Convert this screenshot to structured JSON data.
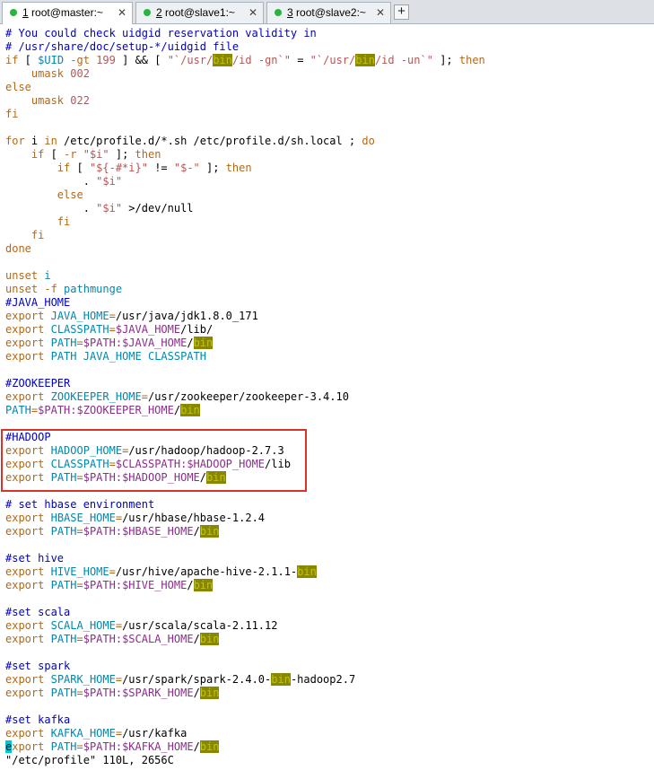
{
  "tabs": [
    {
      "num": "1",
      "title": "root@master:~",
      "close": "✕",
      "active": true
    },
    {
      "num": "2",
      "title": "root@slave1:~",
      "close": "✕",
      "active": false
    },
    {
      "num": "3",
      "title": "root@slave2:~",
      "close": "✕",
      "active": false
    }
  ],
  "new_tab_label": "+",
  "colors": {
    "comment": "#0000c0",
    "keyword": "#b26818",
    "string": "#b65555",
    "variable": "#0087af",
    "path": "#8a2d8a",
    "search_highlight": "#878700",
    "cursor": "#00c8d8",
    "annotation_box": "#d9342b",
    "running_dot": "#27b53f"
  },
  "terminal": {
    "lines": [
      [
        [
          "c",
          "# You could check uidgid reservation validity in"
        ]
      ],
      [
        [
          "c",
          "# /usr/share/doc/setup-*/uidgid file"
        ]
      ],
      [
        [
          "k",
          "if"
        ],
        [
          "p",
          " [ "
        ],
        [
          "v",
          "$UID"
        ],
        [
          "p",
          " "
        ],
        [
          "k",
          "-gt"
        ],
        [
          "p",
          " "
        ],
        [
          "s",
          "199"
        ],
        [
          "p",
          " ] && [ "
        ],
        [
          "s",
          "\"`/usr/"
        ],
        [
          "h",
          "bin"
        ],
        [
          "s",
          "/id -gn`\""
        ],
        [
          "p",
          " = "
        ],
        [
          "s",
          "\"`/usr/"
        ],
        [
          "h",
          "bin"
        ],
        [
          "s",
          "/id -un`\""
        ],
        [
          "p",
          " ]; "
        ],
        [
          "k",
          "then"
        ]
      ],
      [
        [
          "p",
          "    "
        ],
        [
          "k",
          "umask"
        ],
        [
          "p",
          " "
        ],
        [
          "s",
          "002"
        ]
      ],
      [
        [
          "k",
          "else"
        ]
      ],
      [
        [
          "p",
          "    "
        ],
        [
          "k",
          "umask"
        ],
        [
          "p",
          " "
        ],
        [
          "s",
          "022"
        ]
      ],
      [
        [
          "k",
          "fi"
        ]
      ],
      [
        [
          "p",
          ""
        ]
      ],
      [
        [
          "k",
          "for"
        ],
        [
          "p",
          " i "
        ],
        [
          "k",
          "in"
        ],
        [
          "p",
          " /etc/profile.d/*.sh /etc/profile.d/sh.local ; "
        ],
        [
          "k",
          "do"
        ]
      ],
      [
        [
          "p",
          "    "
        ],
        [
          "k",
          "if"
        ],
        [
          "p",
          " [ "
        ],
        [
          "k",
          "-r"
        ],
        [
          "p",
          " "
        ],
        [
          "s",
          "\"$i\""
        ],
        [
          "p",
          " ]; "
        ],
        [
          "k",
          "then"
        ]
      ],
      [
        [
          "p",
          "        "
        ],
        [
          "k",
          "if"
        ],
        [
          "p",
          " [ "
        ],
        [
          "s",
          "\"${-#*i}\""
        ],
        [
          "p",
          " != "
        ],
        [
          "s",
          "\"$-\""
        ],
        [
          "p",
          " ]; "
        ],
        [
          "k",
          "then"
        ]
      ],
      [
        [
          "p",
          "            . "
        ],
        [
          "s",
          "\"$i\""
        ]
      ],
      [
        [
          "p",
          "        "
        ],
        [
          "k",
          "else"
        ]
      ],
      [
        [
          "p",
          "            . "
        ],
        [
          "s",
          "\"$i\""
        ],
        [
          "p",
          " >/dev/null"
        ]
      ],
      [
        [
          "p",
          "        "
        ],
        [
          "k",
          "fi"
        ]
      ],
      [
        [
          "p",
          "    "
        ],
        [
          "k",
          "fi"
        ]
      ],
      [
        [
          "k",
          "done"
        ]
      ],
      [
        [
          "p",
          ""
        ]
      ],
      [
        [
          "k",
          "unset"
        ],
        [
          "p",
          " "
        ],
        [
          "v",
          "i"
        ]
      ],
      [
        [
          "k",
          "unset"
        ],
        [
          "p",
          " "
        ],
        [
          "k",
          "-f"
        ],
        [
          "p",
          " "
        ],
        [
          "v",
          "pathmunge"
        ]
      ],
      [
        [
          "c",
          "#JAVA_HOME"
        ]
      ],
      [
        [
          "k",
          "export"
        ],
        [
          "p",
          " "
        ],
        [
          "v",
          "JAVA_HOME"
        ],
        [
          "k",
          "="
        ],
        [
          "p",
          "/usr/java/jdk1.8.0_171"
        ]
      ],
      [
        [
          "k",
          "export"
        ],
        [
          "p",
          " "
        ],
        [
          "v",
          "CLASSPATH"
        ],
        [
          "k",
          "="
        ],
        [
          "x",
          "$JAVA_HOME"
        ],
        [
          "p",
          "/lib/"
        ]
      ],
      [
        [
          "k",
          "export"
        ],
        [
          "p",
          " "
        ],
        [
          "v",
          "PATH"
        ],
        [
          "k",
          "="
        ],
        [
          "x",
          "$PATH:$JAVA_HOME"
        ],
        [
          "p",
          "/"
        ],
        [
          "h",
          "bin"
        ]
      ],
      [
        [
          "k",
          "export"
        ],
        [
          "p",
          " "
        ],
        [
          "v",
          "PATH JAVA_HOME CLASSPATH"
        ]
      ],
      [
        [
          "p",
          ""
        ]
      ],
      [
        [
          "c",
          "#ZOOKEEPER"
        ]
      ],
      [
        [
          "k",
          "export"
        ],
        [
          "p",
          " "
        ],
        [
          "v",
          "ZOOKEEPER_HOME"
        ],
        [
          "k",
          "="
        ],
        [
          "p",
          "/usr/zookeeper/zookeeper-3.4.10"
        ]
      ],
      [
        [
          "v",
          "PATH"
        ],
        [
          "k",
          "="
        ],
        [
          "x",
          "$PATH:$ZOOKEEPER_HOME"
        ],
        [
          "p",
          "/"
        ],
        [
          "h",
          "bin"
        ]
      ],
      [
        [
          "p",
          ""
        ]
      ],
      [
        [
          "c",
          "#HADOOP"
        ]
      ],
      [
        [
          "k",
          "export"
        ],
        [
          "p",
          " "
        ],
        [
          "v",
          "HADOOP_HOME"
        ],
        [
          "k",
          "="
        ],
        [
          "p",
          "/usr/hadoop/hadoop-2.7.3"
        ]
      ],
      [
        [
          "k",
          "export"
        ],
        [
          "p",
          " "
        ],
        [
          "v",
          "CLASSPATH"
        ],
        [
          "k",
          "="
        ],
        [
          "x",
          "$CLASSPATH:$HADOOP_HOME"
        ],
        [
          "p",
          "/lib"
        ]
      ],
      [
        [
          "k",
          "export"
        ],
        [
          "p",
          " "
        ],
        [
          "v",
          "PATH"
        ],
        [
          "k",
          "="
        ],
        [
          "x",
          "$PATH:$HADOOP_HOME"
        ],
        [
          "p",
          "/"
        ],
        [
          "h",
          "bin"
        ]
      ],
      [
        [
          "p",
          ""
        ]
      ],
      [
        [
          "c",
          "# set hbase environment"
        ]
      ],
      [
        [
          "k",
          "export"
        ],
        [
          "p",
          " "
        ],
        [
          "v",
          "HBASE_HOME"
        ],
        [
          "k",
          "="
        ],
        [
          "p",
          "/usr/hbase/hbase-1.2.4"
        ]
      ],
      [
        [
          "k",
          "export"
        ],
        [
          "p",
          " "
        ],
        [
          "v",
          "PATH"
        ],
        [
          "k",
          "="
        ],
        [
          "x",
          "$PATH:$HBASE_HOME"
        ],
        [
          "p",
          "/"
        ],
        [
          "h",
          "bin"
        ]
      ],
      [
        [
          "p",
          ""
        ]
      ],
      [
        [
          "c",
          "#set hive"
        ]
      ],
      [
        [
          "k",
          "export"
        ],
        [
          "p",
          " "
        ],
        [
          "v",
          "HIVE_HOME"
        ],
        [
          "k",
          "="
        ],
        [
          "p",
          "/usr/hive/apache-hive-2.1.1-"
        ],
        [
          "h",
          "bin"
        ]
      ],
      [
        [
          "k",
          "export"
        ],
        [
          "p",
          " "
        ],
        [
          "v",
          "PATH"
        ],
        [
          "k",
          "="
        ],
        [
          "x",
          "$PATH:$HIVE_HOME"
        ],
        [
          "p",
          "/"
        ],
        [
          "h",
          "bin"
        ]
      ],
      [
        [
          "p",
          ""
        ]
      ],
      [
        [
          "c",
          "#set scala"
        ]
      ],
      [
        [
          "k",
          "export"
        ],
        [
          "p",
          " "
        ],
        [
          "v",
          "SCALA_HOME"
        ],
        [
          "k",
          "="
        ],
        [
          "p",
          "/usr/scala/scala-2.11.12"
        ]
      ],
      [
        [
          "k",
          "export"
        ],
        [
          "p",
          " "
        ],
        [
          "v",
          "PATH"
        ],
        [
          "k",
          "="
        ],
        [
          "x",
          "$PATH:$SCALA_HOME"
        ],
        [
          "p",
          "/"
        ],
        [
          "h",
          "bin"
        ]
      ],
      [
        [
          "p",
          ""
        ]
      ],
      [
        [
          "c",
          "#set spark"
        ]
      ],
      [
        [
          "k",
          "export"
        ],
        [
          "p",
          " "
        ],
        [
          "v",
          "SPARK_HOME"
        ],
        [
          "k",
          "="
        ],
        [
          "p",
          "/usr/spark/spark-2.4.0-"
        ],
        [
          "h",
          "bin"
        ],
        [
          "p",
          "-hadoop2.7"
        ]
      ],
      [
        [
          "k",
          "export"
        ],
        [
          "p",
          " "
        ],
        [
          "v",
          "PATH"
        ],
        [
          "k",
          "="
        ],
        [
          "x",
          "$PATH:$SPARK_HOME"
        ],
        [
          "p",
          "/"
        ],
        [
          "h",
          "bin"
        ]
      ],
      [
        [
          "p",
          ""
        ]
      ],
      [
        [
          "c",
          "#set kafka"
        ]
      ],
      [
        [
          "k",
          "export"
        ],
        [
          "p",
          " "
        ],
        [
          "v",
          "KAFKA_HOME"
        ],
        [
          "k",
          "="
        ],
        [
          "p",
          "/usr/kafka"
        ]
      ],
      [
        [
          "u",
          "e"
        ],
        [
          "k",
          "xport"
        ],
        [
          "p",
          " "
        ],
        [
          "v",
          "PATH"
        ],
        [
          "k",
          "="
        ],
        [
          "x",
          "$PATH:$KAFKA_HOME"
        ],
        [
          "p",
          "/"
        ],
        [
          "h",
          "bin"
        ]
      ],
      [
        [
          "t",
          "\"/etc/profile\" 110L, 2656C"
        ]
      ]
    ]
  }
}
